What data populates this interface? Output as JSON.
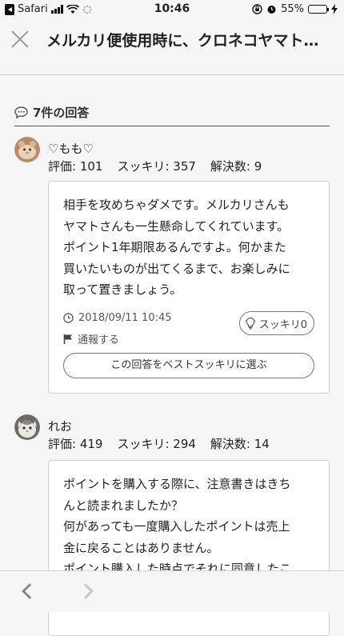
{
  "status_bar": {
    "app": "Safari",
    "time": "10:46",
    "battery": "55%",
    "battery_level": 0.55
  },
  "header": {
    "title": "メルカリ便使用時に、クロネコヤマト…"
  },
  "answers_section": {
    "title": "7件の回答"
  },
  "answers": [
    {
      "name": "♡もも♡",
      "rating": "評価: 101",
      "sukkiri_count": "スッキリ: 357",
      "solved": "解決数: 9",
      "body": [
        "相手を攻めちゃダメです。メルカリさんも",
        "ヤマトさんも一生懸命してくれています。",
        "ポイント1年期限あるんですよ。何かまた",
        "買いたいものが出てくるまで、お楽しみに",
        "取って置きましょう。"
      ],
      "date": "2018/09/11 10:45",
      "report": "通報する",
      "sukkiri_button": "スッキリ0",
      "best_button": "この回答をベストスッキリに選ぶ"
    },
    {
      "name": "れお",
      "rating": "評価: 419",
      "sukkiri_count": "スッキリ: 294",
      "solved": "解決数: 14",
      "body": [
        "ポイントを購入する際に、注意書きはきち",
        "んと読まれましたか？",
        "何があっても一度購入したポイントは売上",
        "金に戻ることはありません。",
        "ポイント購入した時点でそれに同意したこ"
      ]
    }
  ],
  "colors": {
    "background": "#f6f6f6",
    "card": "#ffffff",
    "battery": "#4cd964"
  }
}
